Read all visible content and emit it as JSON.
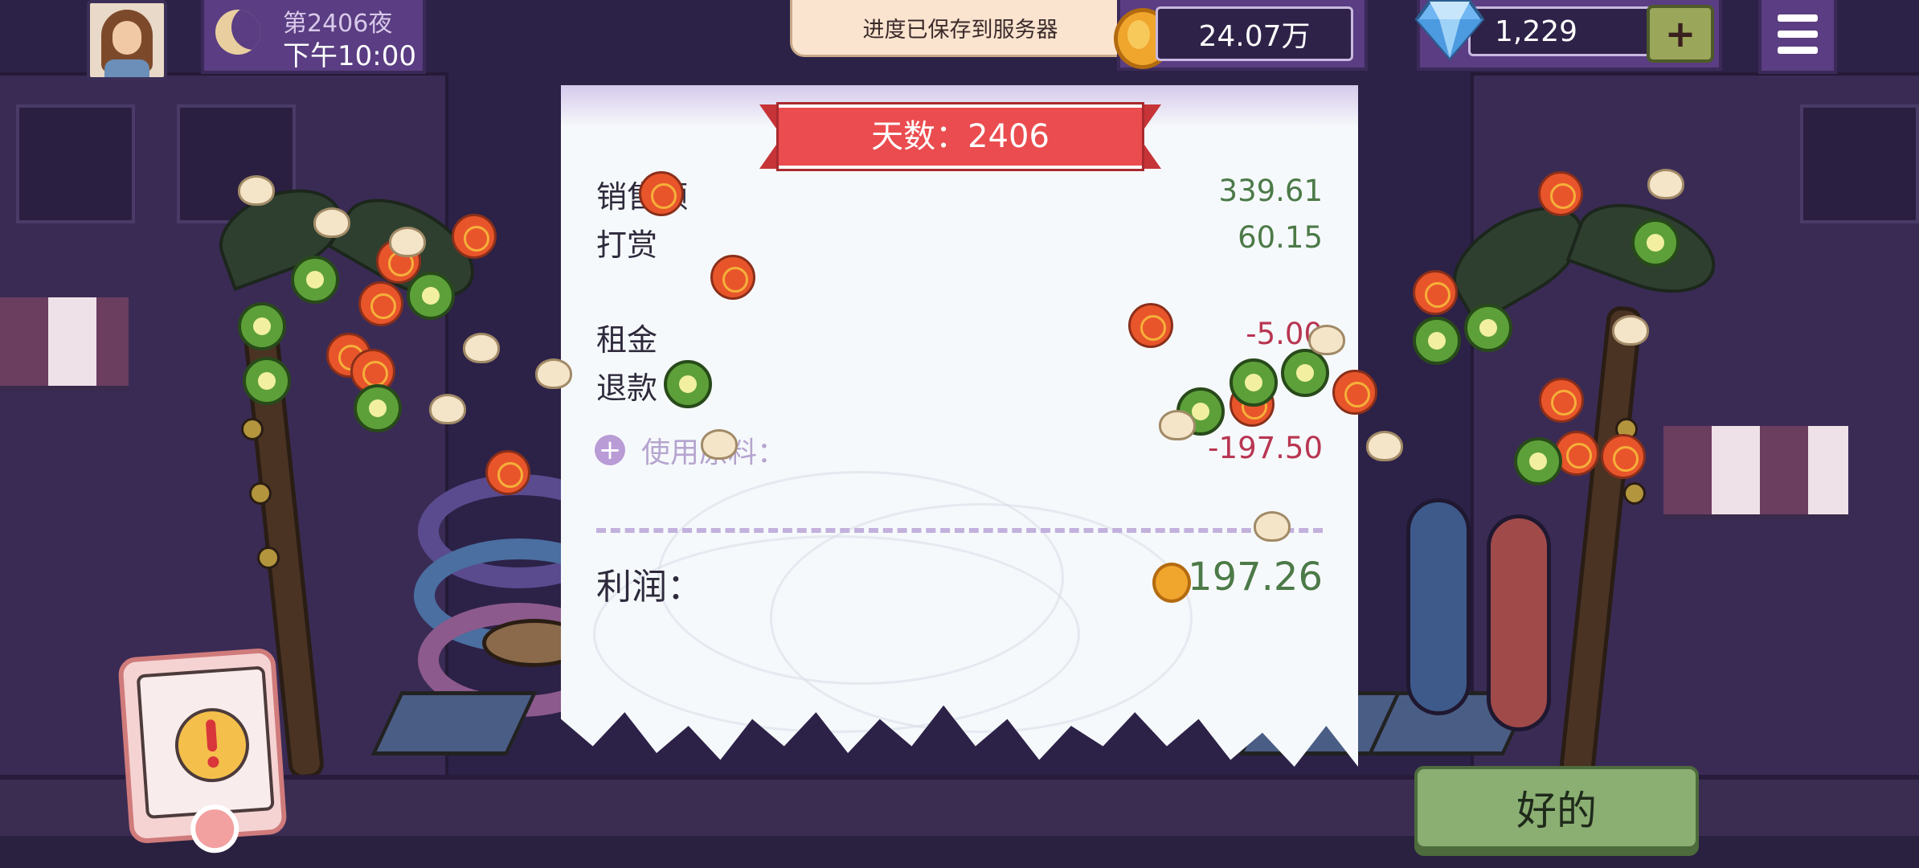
{
  "hud": {
    "avatar": "player-avatar",
    "day_night": "第2406夜",
    "time": "下午10:00",
    "toast": "进度已保存到服务器",
    "coins": "24.07万",
    "gems": "1,229",
    "plus": "+"
  },
  "receipt": {
    "title": "天数：2406",
    "rows": [
      {
        "label": "销售额",
        "value": "339.61"
      },
      {
        "label": "打赏",
        "value": "60.15"
      },
      {
        "label": "租金",
        "value": "-5.00"
      },
      {
        "label": "退款",
        "value": ""
      }
    ],
    "ingredients_label": "使用原料：",
    "ingredients_value": "-197.50",
    "profit_label": "利润：",
    "profit_value": "197.26"
  },
  "buttons": {
    "ok": "好的"
  },
  "colors": {
    "positive": "#4c7a48",
    "negative": "#b83652",
    "ribbon": "#ea4c4f",
    "ok_button": "#8bae73",
    "hud_panel": "#5a3d82"
  },
  "icons": [
    "moon-icon",
    "coin-icon",
    "gem-icon",
    "menu-icon",
    "plus-circle-icon",
    "alert-icon"
  ]
}
